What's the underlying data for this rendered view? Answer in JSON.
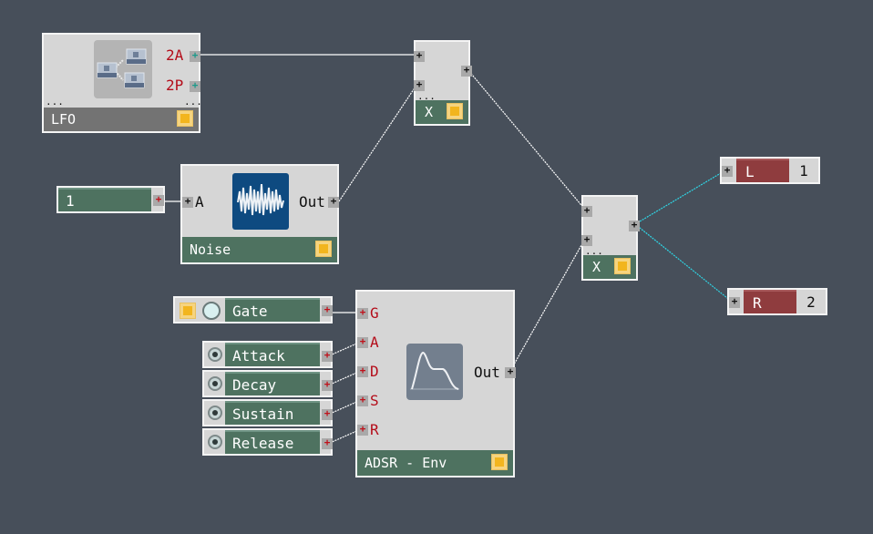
{
  "modules": {
    "lfo": {
      "title": "LFO",
      "ports_out": [
        "2A",
        "2P"
      ],
      "icon": "lfo-network-icon",
      "dots_left": "...",
      "dots_right": "..."
    },
    "mult1": {
      "title": "X",
      "dots": "...",
      "icon": "multiply"
    },
    "noise": {
      "title": "Noise",
      "port_in": "A",
      "port_out": "Out",
      "icon": "noise-waveform-icon"
    },
    "mult2": {
      "title": "X",
      "dots": "...",
      "icon": "multiply"
    },
    "adsr": {
      "title": "ADSR - Env",
      "ports_in": [
        "G",
        "A",
        "D",
        "S",
        "R"
      ],
      "port_out": "Out",
      "icon": "envelope-curve-icon"
    }
  },
  "controls": {
    "constant": {
      "value": "1"
    },
    "gate": {
      "label": "Gate"
    },
    "knobs": [
      {
        "label": "Attack"
      },
      {
        "label": "Decay"
      },
      {
        "label": "Sustain"
      },
      {
        "label": "Release"
      }
    ]
  },
  "outputs": [
    {
      "label": "L",
      "channel": "1"
    },
    {
      "label": "R",
      "channel": "2"
    }
  ],
  "colors": {
    "background": "#474f5a",
    "module_bg": "#d6d6d6",
    "module_bar_green": "#4e7260",
    "module_bar_gray": "#737373",
    "output_red": "#8f3c3e",
    "port_label_red": "#b40d1a",
    "wire_white": "#ffffff",
    "wire_cyan": "#2fd6e6",
    "button_yellow": "#f2b51e"
  }
}
